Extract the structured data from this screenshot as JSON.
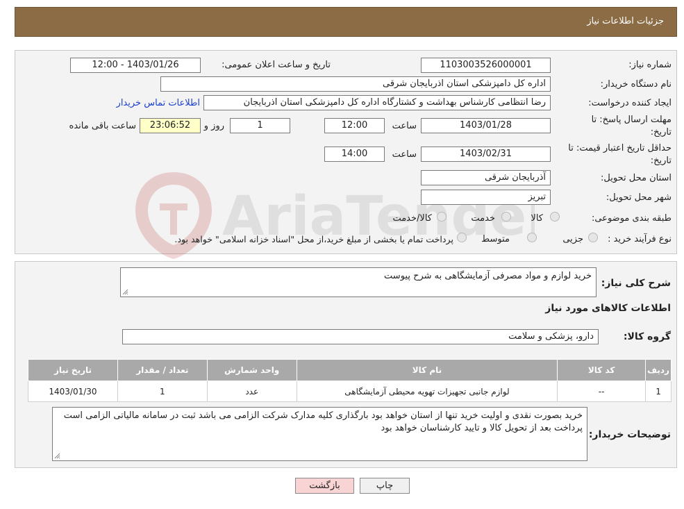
{
  "header": {
    "title": "جزئیات اطلاعات نیاز"
  },
  "fields": {
    "need_number_label": "شماره نیاز:",
    "need_number": "1103003526000001",
    "announce_label": "تاریخ و ساعت اعلان عمومی:",
    "announce_value": "1403/01/26 - 12:00",
    "buyer_label": "نام دستگاه خریدار:",
    "buyer_value": "اداره کل دامپزشکی استان اذربایجان شرقی",
    "creator_label": "ایجاد کننده درخواست:",
    "creator_value": "رضا انتظامی کارشناس بهداشت و کشتارگاه اداره کل دامپزشکی استان اذربایجان",
    "contact_link": "اطلاعات تماس خریدار",
    "deadline_label_1": "مهلت ارسال پاسخ: تا",
    "deadline_label_2": "تاریخ:",
    "deadline_date": "1403/01/28",
    "time_label": "ساعت",
    "deadline_time": "12:00",
    "days_value": "1",
    "days_label": "روز و",
    "remaining_time": "23:06:52",
    "remaining_label": "ساعت باقی مانده",
    "validity_label_1": "حداقل تاریخ اعتبار قیمت: تا",
    "validity_label_2": "تاریخ:",
    "validity_date": "1403/02/31",
    "validity_time": "14:00",
    "province_label": "استان محل تحویل:",
    "province_value": "آذربایجان شرقی",
    "city_label": "شهر محل تحویل:",
    "city_value": "تبریز",
    "category_label": "طبقه بندی موضوعی:",
    "category_options": [
      "کالا",
      "خدمت",
      "کالا/خدمت"
    ],
    "process_label": "نوع فرآیند خرید :",
    "process_options": [
      "جزیی",
      "متوسط"
    ],
    "process_note": "پرداخت تمام یا بخشی از مبلغ خرید،از محل \"اسناد خزانه اسلامی\" خواهد بود."
  },
  "details": {
    "summary_label": "شرح کلی نیاز:",
    "summary_value": "خرید لوازم و مواد مصرفی آزمایشگاهی به شرح پیوست",
    "goods_title": "اطلاعات کالاهای مورد نیاز",
    "group_label": "گروه کالا:",
    "group_value": "دارو، پزشکی و سلامت"
  },
  "table": {
    "headers": [
      "ردیف",
      "کد کالا",
      "نام کالا",
      "واحد شمارش",
      "تعداد / مقدار",
      "تاریخ نیاز"
    ],
    "rows": [
      [
        "1",
        "--",
        "لوازم جانبی تجهیزات تهویه محیطی آزمایشگاهی",
        "عدد",
        "1",
        "1403/01/30"
      ]
    ]
  },
  "buyer_notes": {
    "label": "توضیحات خریدار:",
    "value": "خرید بصورت نقدی و اولیت خرید  تنها از استان خواهد بود بارگذاری کلیه مدارک شرکت الزامی می باشد ثبت در سامانه مالیاتی الزامی است پرداخت بعد از تحویل کالا و تایید کارشناسان خواهد بود"
  },
  "buttons": {
    "print": "چاپ",
    "back": "بازگشت"
  },
  "watermark": {
    "text": "AriaTender.neT"
  },
  "colors": {
    "header_bg": "#8b6c45",
    "link": "#1a3ecc",
    "back_button": "#f8d4d4",
    "remaining_bg": "#ffffc8"
  }
}
